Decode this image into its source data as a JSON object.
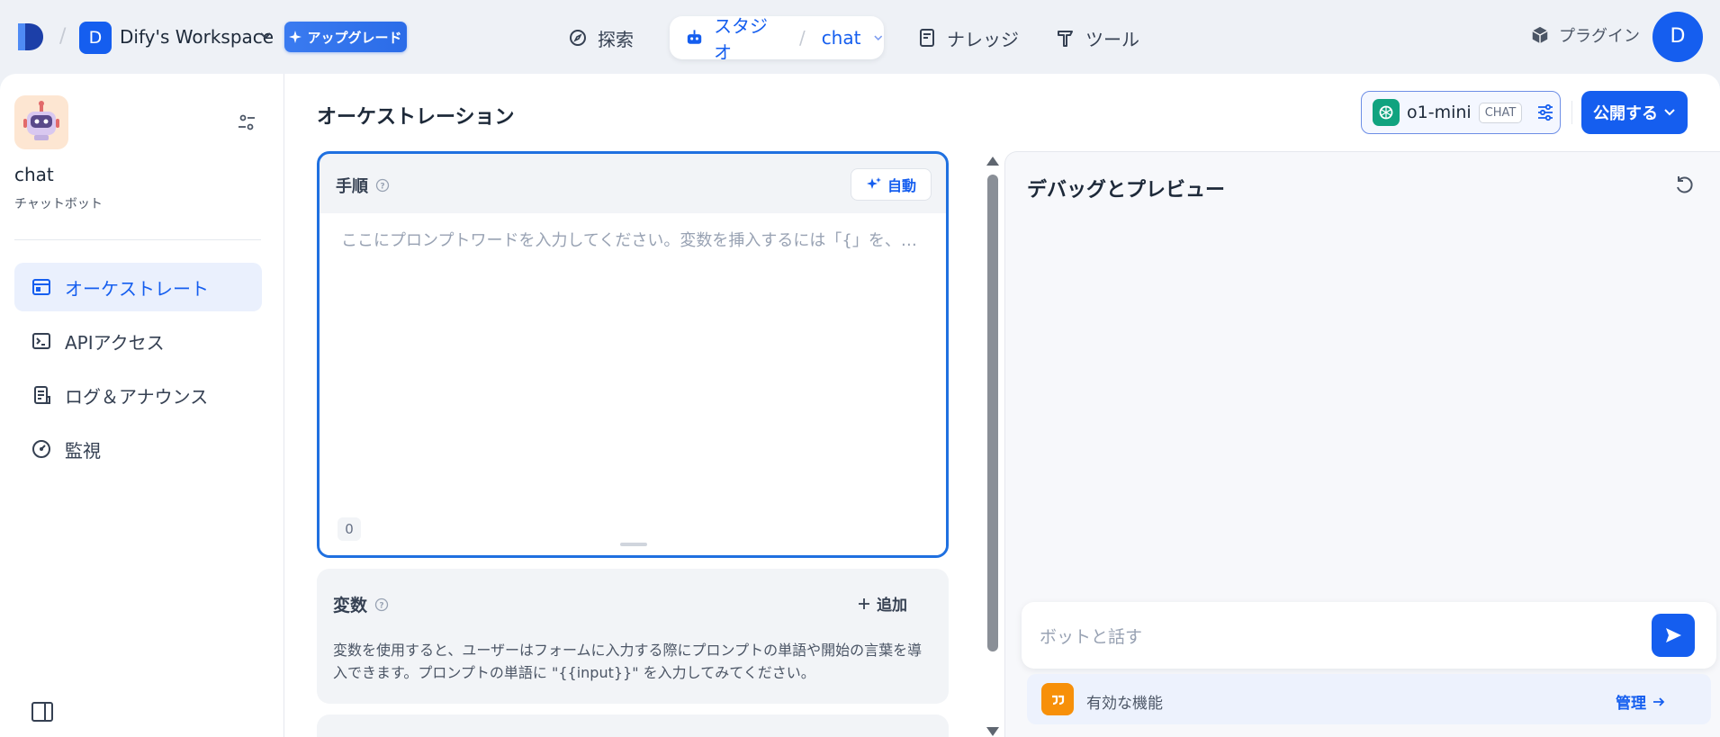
{
  "header": {
    "workspace_initial": "D",
    "workspace_name": "Dify's Workspace",
    "upgrade_label": "アップグレード",
    "nav": {
      "explore": "探索",
      "studio": "スタジオ",
      "current_app": "chat",
      "knowledge": "ナレッジ",
      "tools": "ツール",
      "plugins": "プラグイン"
    },
    "user_initial": "D"
  },
  "sidebar": {
    "app_name": "chat",
    "app_type": "チャットボット",
    "items": [
      {
        "label": "オーケストレート",
        "icon": "layout-icon",
        "active": true
      },
      {
        "label": "APIアクセス",
        "icon": "terminal-icon",
        "active": false
      },
      {
        "label": "ログ＆アナウンス",
        "icon": "file-list-icon",
        "active": false
      },
      {
        "label": "監視",
        "icon": "dashboard-icon",
        "active": false
      }
    ]
  },
  "main": {
    "title": "オーケストレーション",
    "model": {
      "name": "o1-mini",
      "mode_tag": "CHAT"
    },
    "publish_label": "公開する",
    "prompt": {
      "title": "手順",
      "auto_label": "自動",
      "placeholder": "ここにプロンプトワードを入力してください。変数を挿入するには「{」を、プロンプトコンテンツブロックを挿入するには「/」を入力します。",
      "char_count": "0"
    },
    "variables": {
      "title": "変数",
      "add_label": "追加",
      "description": "変数を使用すると、ユーザーはフォームに入力する際にプロンプトの単語や開始の言葉を導入できます。プロンプトの単語に \"{{input}}\" を入力してみてください。"
    }
  },
  "debug": {
    "title": "デバッグとプレビュー",
    "chat_placeholder": "ボットと話す",
    "features_label": "有効な機能",
    "manage_label": "管理"
  },
  "colors": {
    "accent": "#155eef",
    "active_bg": "#eaf0fd",
    "prompt_border": "#1f70e0",
    "openai": "#10a37f",
    "feature_icon": "#f79009"
  }
}
